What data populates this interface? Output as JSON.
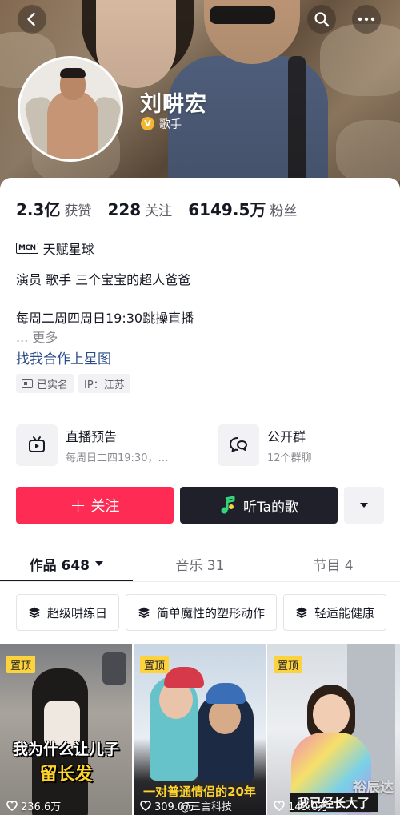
{
  "header": {
    "name": "刘畊宏",
    "verified_badge": "V",
    "verified_title": "歌手"
  },
  "stats": [
    {
      "value": "2.3亿",
      "label": "获赞"
    },
    {
      "value": "228",
      "label": "关注"
    },
    {
      "value": "6149.5万",
      "label": "粉丝"
    }
  ],
  "profile": {
    "mcn_icon": "MCN",
    "mcn_name": "天赋星球",
    "bio_line1": "演员 歌手 三个宝宝的超人爸爸",
    "bio_line2": "每周二周四周日19:30跳操直播",
    "more": "... 更多",
    "star_link": "找我合作上星图",
    "tags": [
      "已实名",
      "IP：江苏"
    ]
  },
  "features": [
    {
      "title": "直播预告",
      "subtitle": "每周日二四19:30，…",
      "icon": "tv-icon"
    },
    {
      "title": "公开群",
      "subtitle": "12个群聊",
      "icon": "chat-icon"
    }
  ],
  "actions": {
    "follow": "关注",
    "listen": "听Ta的歌"
  },
  "tabs": [
    {
      "label": "作品 648"
    },
    {
      "label": "音乐 31"
    },
    {
      "label": "节目 4"
    }
  ],
  "chips": [
    "超级畊练日",
    "简单魔性的塑形动作",
    "轻适能健康"
  ],
  "videos": [
    {
      "pinned": "置顶",
      "caption_line1": "我为什么让儿子",
      "caption_line2": "留长发",
      "likes": "236.6万"
    },
    {
      "pinned": "置顶",
      "caption_line1": "一对普通情侣的20年",
      "likes": "309.0万"
    },
    {
      "pinned": "置顶",
      "caption_line1": "我已经长大了",
      "likes": "145.0万"
    }
  ],
  "watermarks": [
    "@三言科技",
    "裕辰达"
  ],
  "colors": {
    "accent": "#fe2c55",
    "dark_button": "#1f2029",
    "pin": "#fcd33c",
    "link": "#2a4b8a"
  }
}
